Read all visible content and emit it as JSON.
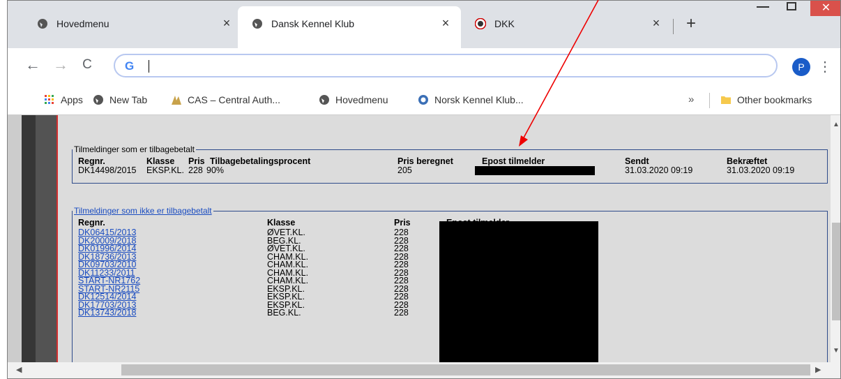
{
  "tabs": [
    {
      "label": "Hovedmenu",
      "favicon": "globe-icon",
      "close": "×"
    },
    {
      "label": "Dansk Kennel Klub",
      "favicon": "globe-icon",
      "close": "×"
    },
    {
      "label": "DKK",
      "favicon": "dkk-logo-icon",
      "close": "×"
    }
  ],
  "window": {
    "close_label": "✕"
  },
  "toolbar": {
    "back": "←",
    "forward": "→",
    "reload": "C",
    "omnibox_g": "G",
    "profile_initial": "P",
    "menu": "⋮"
  },
  "bookmarks": {
    "items": [
      {
        "label": "Apps"
      },
      {
        "label": "New Tab"
      },
      {
        "label": "CAS – Central Auth..."
      },
      {
        "label": "Hovedmenu"
      },
      {
        "label": "Norsk Kennel Klub..."
      }
    ],
    "more": "»",
    "other": "Other bookmarks"
  },
  "refunded": {
    "legend": "Tilmeldinger som er tilbagebetalt",
    "headers": {
      "regnr": "Regnr.",
      "klasse": "Klasse",
      "pris": "Pris",
      "procent": "Tilbagebetalingsprocent",
      "beregnet": "Pris beregnet",
      "epost": "Epost tilmelder",
      "sendt": "Sendt",
      "bekraeftet": "Bekræftet"
    },
    "row": {
      "regnr": "DK14498/2015",
      "klasse": "EKSP.KL.",
      "pris": "228",
      "procent": "90%",
      "beregnet": "205",
      "sendt": "31.03.2020 09:19",
      "bekraeftet": "31.03.2020 09:19"
    }
  },
  "not_refunded": {
    "legend": "Tilmeldinger som ikke er tilbagebetalt",
    "headers": {
      "regnr": "Regnr.",
      "klasse": "Klasse",
      "pris": "Pris",
      "epost": "Epost tilmelder"
    },
    "rows": [
      {
        "regnr": "DK06415/2013",
        "klasse": "ØVET.KL.",
        "pris": "228"
      },
      {
        "regnr": "DK20009/2018",
        "klasse": "BEG.KL.",
        "pris": "228"
      },
      {
        "regnr": "DK01996/2014",
        "klasse": "ØVET.KL.",
        "pris": "228"
      },
      {
        "regnr": "DK18736/2013",
        "klasse": "CHAM.KL.",
        "pris": "228"
      },
      {
        "regnr": "DK09703/2010",
        "klasse": "CHAM.KL.",
        "pris": "228"
      },
      {
        "regnr": "DK11233/2011",
        "klasse": "CHAM.KL.",
        "pris": "228"
      },
      {
        "regnr": "START-NR1762",
        "klasse": "CHAM.KL.",
        "pris": "228"
      },
      {
        "regnr": "START-NR2115",
        "klasse": "EKSP.KL.",
        "pris": "228"
      },
      {
        "regnr": "DK12514/2014",
        "klasse": "EKSP.KL.",
        "pris": "228"
      },
      {
        "regnr": "DK17703/2013",
        "klasse": "EKSP.KL.",
        "pris": "228"
      },
      {
        "regnr": "DK13743/2018",
        "klasse": "BEG.KL.",
        "pris": "228"
      }
    ]
  }
}
